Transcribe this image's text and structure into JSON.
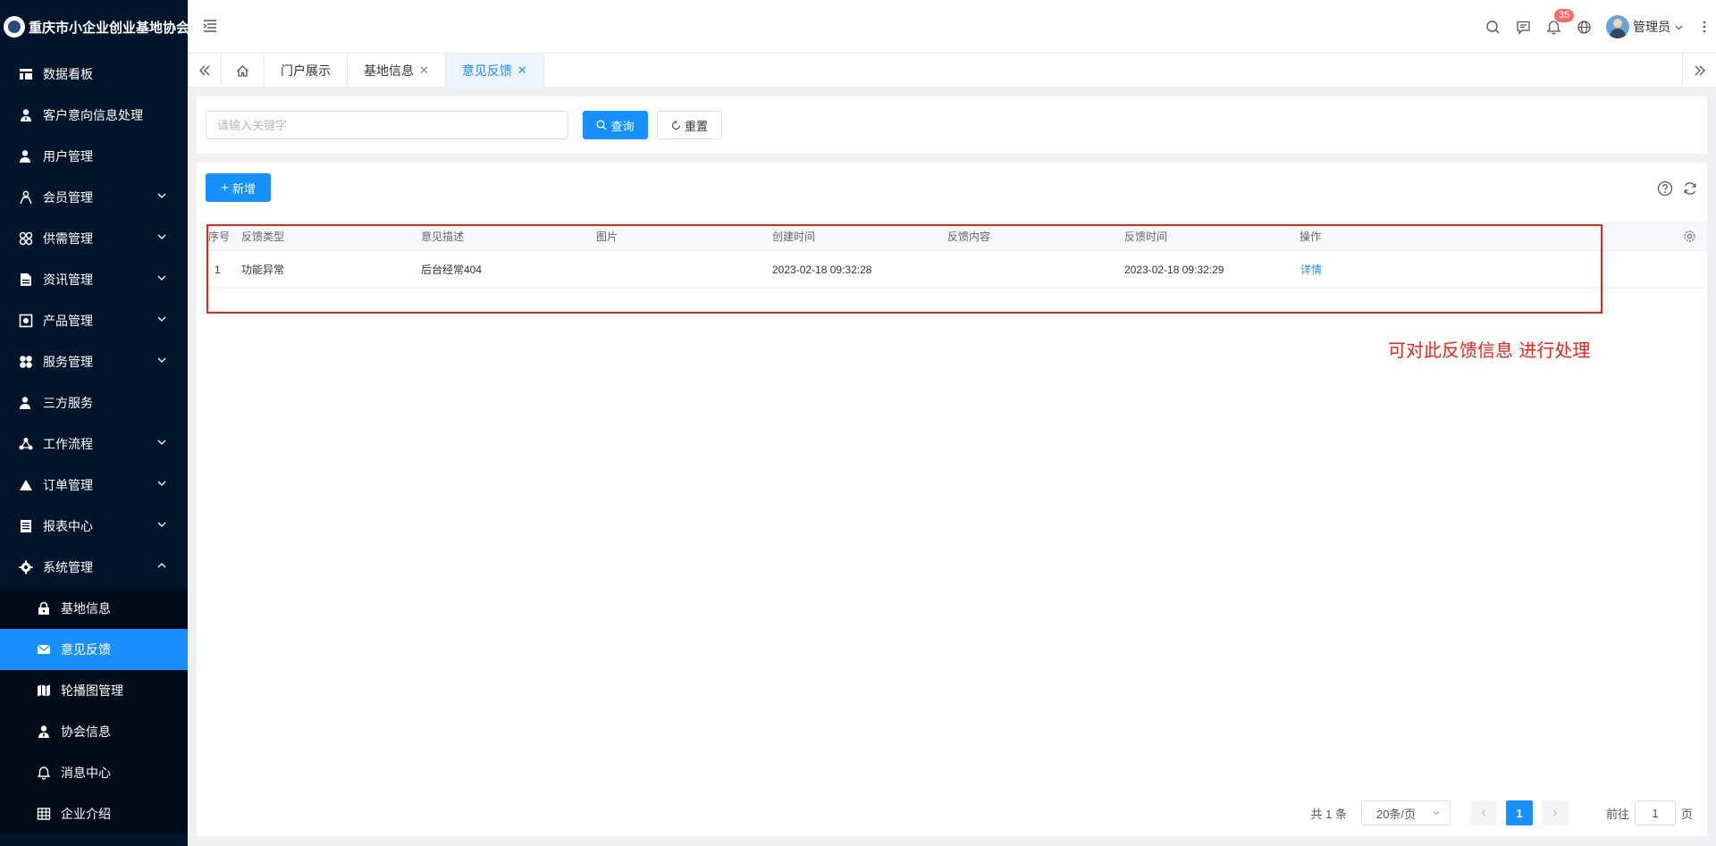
{
  "brand": {
    "title": "重庆市小企业创业基地协会"
  },
  "sidebar": {
    "items": [
      {
        "label": "数据看板",
        "icon": "dashboard-icon",
        "expandable": false
      },
      {
        "label": "客户意向信息处理",
        "icon": "user-tie-icon",
        "expandable": false
      },
      {
        "label": "用户管理",
        "icon": "user-icon",
        "expandable": false
      },
      {
        "label": "会员管理",
        "icon": "members-icon",
        "expandable": true
      },
      {
        "label": "供需管理",
        "icon": "cluster-icon",
        "expandable": true
      },
      {
        "label": "资讯管理",
        "icon": "document-icon",
        "expandable": true
      },
      {
        "label": "产品管理",
        "icon": "product-icon",
        "expandable": true
      },
      {
        "label": "服务管理",
        "icon": "service-icon",
        "expandable": true
      },
      {
        "label": "三方服务",
        "icon": "user-icon",
        "expandable": false
      },
      {
        "label": "工作流程",
        "icon": "workflow-icon",
        "expandable": true
      },
      {
        "label": "订单管理",
        "icon": "triangle-icon",
        "expandable": true
      },
      {
        "label": "报表中心",
        "icon": "report-icon",
        "expandable": true
      },
      {
        "label": "系统管理",
        "icon": "gear-icon",
        "expandable": true,
        "expanded": true
      }
    ],
    "subitems": [
      {
        "label": "基地信息",
        "icon": "lock-icon",
        "active": false
      },
      {
        "label": "意见反馈",
        "icon": "mail-icon",
        "active": true
      },
      {
        "label": "轮播图管理",
        "icon": "map-icon",
        "active": false
      },
      {
        "label": "协会信息",
        "icon": "user-tie-icon",
        "active": false
      },
      {
        "label": "消息中心",
        "icon": "bell-icon",
        "active": false
      },
      {
        "label": "企业介绍",
        "icon": "grid-icon",
        "active": false
      }
    ]
  },
  "header": {
    "notification_count": "35",
    "user_name": "管理员"
  },
  "tabs": [
    {
      "label": "门户展示",
      "closable": false,
      "active": false
    },
    {
      "label": "基地信息",
      "closable": true,
      "active": false
    },
    {
      "label": "意见反馈",
      "closable": true,
      "active": true
    }
  ],
  "search": {
    "placeholder": "请输入关键字",
    "query_label": "查询",
    "reset_label": "重置"
  },
  "toolbar": {
    "add_label": "新增"
  },
  "table": {
    "columns": [
      "序号",
      "反馈类型",
      "意见描述",
      "图片",
      "创建时间",
      "反馈内容",
      "反馈时间",
      "操作"
    ],
    "rows": [
      {
        "index": "1",
        "type": "功能异常",
        "description": "后台经常404",
        "image": "",
        "created": "2023-02-18 09:32:28",
        "content": "",
        "feedback_time": "2023-02-18 09:32:29",
        "action": "详情"
      }
    ]
  },
  "annotation": {
    "text": "可对此反馈信息 进行处理",
    "color": "#e5251f"
  },
  "pagination": {
    "total_text": "共 1 条",
    "page_size": "20条/页",
    "current_page": "1",
    "goto_label": "前往",
    "goto_value": "1",
    "page_suffix": "页"
  },
  "colors": {
    "sidebar_bg": "#001529",
    "primary": "#1890ff",
    "active_tab_bg": "#ecf5ff"
  }
}
